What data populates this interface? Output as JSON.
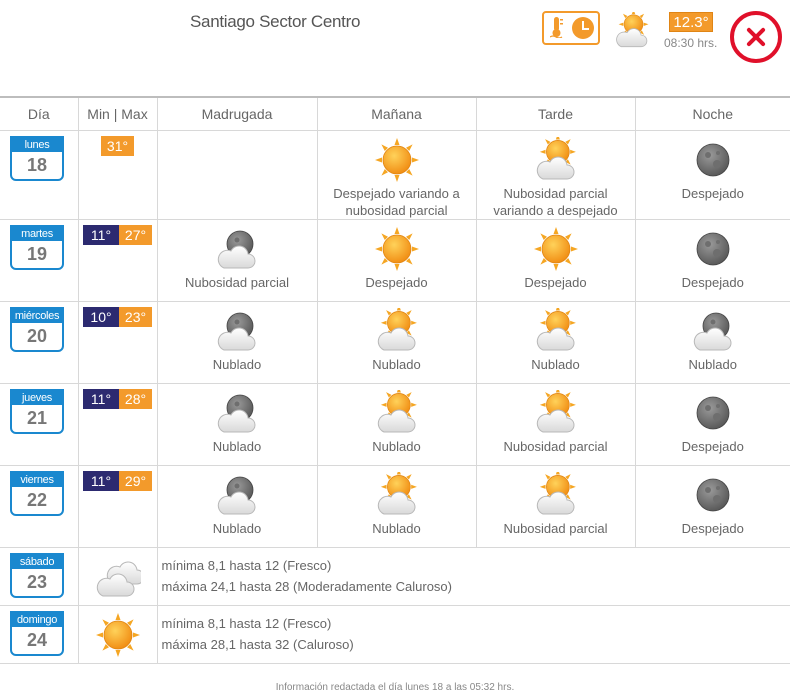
{
  "header": {
    "place": "Santiago Sector Centro",
    "current_temp": "12.3°",
    "current_time": "08:30 hrs.",
    "current_icon": "partly-cloudy-icon"
  },
  "columns": [
    "Día",
    "Min | Max",
    "Madrugada",
    "Mañana",
    "Tarde",
    "Noche"
  ],
  "days": [
    {
      "day": "lunes",
      "num": "18",
      "min": "",
      "max": "31°",
      "periods": [
        {
          "icon": "",
          "label": ""
        },
        {
          "icon": "sun-icon",
          "label": "Despejado variando a nubosidad parcial"
        },
        {
          "icon": "sun-cloud-icon",
          "label": "Nubosidad parcial variando a despejado"
        },
        {
          "icon": "moon-icon",
          "label": "Despejado"
        }
      ]
    },
    {
      "day": "martes",
      "num": "19",
      "min": "11°",
      "max": "27°",
      "periods": [
        {
          "icon": "moon-cloud-icon",
          "label": "Nubosidad parcial"
        },
        {
          "icon": "sun-icon",
          "label": "Despejado"
        },
        {
          "icon": "sun-icon",
          "label": "Despejado"
        },
        {
          "icon": "moon-icon",
          "label": "Despejado"
        }
      ]
    },
    {
      "day": "miércoles",
      "num": "20",
      "min": "10°",
      "max": "23°",
      "periods": [
        {
          "icon": "moon-cloud-icon",
          "label": "Nublado"
        },
        {
          "icon": "sun-cloud-icon",
          "label": "Nublado"
        },
        {
          "icon": "sun-cloud-icon",
          "label": "Nublado"
        },
        {
          "icon": "moon-cloud-icon",
          "label": "Nublado"
        }
      ]
    },
    {
      "day": "jueves",
      "num": "21",
      "min": "11°",
      "max": "28°",
      "periods": [
        {
          "icon": "moon-cloud-icon",
          "label": "Nublado"
        },
        {
          "icon": "sun-cloud-icon",
          "label": "Nublado"
        },
        {
          "icon": "sun-cloud-icon",
          "label": "Nubosidad parcial"
        },
        {
          "icon": "moon-icon",
          "label": "Despejado"
        }
      ]
    },
    {
      "day": "viernes",
      "num": "22",
      "min": "11°",
      "max": "29°",
      "periods": [
        {
          "icon": "moon-cloud-icon",
          "label": "Nublado"
        },
        {
          "icon": "sun-cloud-icon",
          "label": "Nublado"
        },
        {
          "icon": "sun-cloud-icon",
          "label": "Nubosidad parcial"
        },
        {
          "icon": "moon-icon",
          "label": "Despejado"
        }
      ]
    }
  ],
  "extended": [
    {
      "day": "sábado",
      "num": "23",
      "icon": "clouds-icon",
      "line1": "mínima 8,1 hasta 12 (Fresco)",
      "line2": "máxima 24,1 hasta 28 (Moderadamente Caluroso)"
    },
    {
      "day": "domingo",
      "num": "24",
      "icon": "sun-icon",
      "line1": "mínima 8,1 hasta 12 (Fresco)",
      "line2": "máxima 28,1 hasta 32 (Caluroso)"
    }
  ],
  "footer": "Información redactada el día lunes 18 a las 05:32 hrs.",
  "colors": {
    "orange": "#f39a2b",
    "navy": "#2c2a70",
    "blue": "#1a88cf",
    "red": "#e0102a"
  }
}
